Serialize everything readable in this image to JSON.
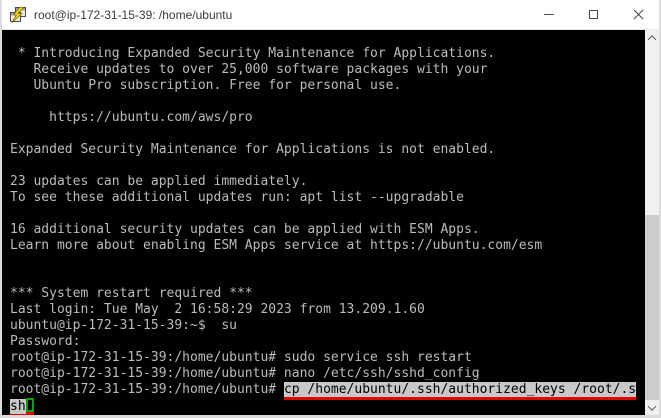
{
  "window": {
    "title": "root@ip-172-31-15-39: /home/ubuntu",
    "app_icon": "putty-icon",
    "controls": [
      "minimize",
      "maximize",
      "close"
    ]
  },
  "colors": {
    "terminal_bg": "#000000",
    "terminal_fg": "#bbbbbb",
    "selection_bg": "#c8c8c8",
    "selection_fg": "#000000",
    "cursor_green": "#00a400",
    "annotation_red": "#e60000",
    "titlebar_bg": "#ffffff",
    "scrollbar_track": "#f0f0f0",
    "scrollbar_thumb": "#cdcdcd"
  },
  "terminal": {
    "lines": [
      [
        {
          "t": ""
        }
      ],
      [
        {
          "t": " * Introducing Expanded Security Maintenance for Applications."
        }
      ],
      [
        {
          "t": "   Receive updates to over 25,000 software packages with your"
        }
      ],
      [
        {
          "t": "   Ubuntu Pro subscription. Free for personal use."
        }
      ],
      [
        {
          "t": ""
        }
      ],
      [
        {
          "t": "     https://ubuntu.com/aws/pro"
        }
      ],
      [
        {
          "t": ""
        }
      ],
      [
        {
          "t": "Expanded Security Maintenance for Applications is not enabled."
        }
      ],
      [
        {
          "t": ""
        }
      ],
      [
        {
          "t": "23 updates can be applied immediately."
        }
      ],
      [
        {
          "t": "To see these additional updates run: apt list --upgradable"
        }
      ],
      [
        {
          "t": ""
        }
      ],
      [
        {
          "t": "16 additional security updates can be applied with ESM Apps."
        }
      ],
      [
        {
          "t": "Learn more about enabling ESM Apps service at https://ubuntu.com/esm"
        }
      ],
      [
        {
          "t": ""
        }
      ],
      [
        {
          "t": ""
        }
      ],
      [
        {
          "t": "*** System restart required ***"
        }
      ],
      [
        {
          "t": "Last login: Tue May  2 16:58:29 2023 from 13.209.1.60"
        }
      ],
      [
        {
          "t": "ubuntu@ip-172-31-15-39:~$  su"
        }
      ],
      [
        {
          "t": "Password:"
        }
      ],
      [
        {
          "t": "root@ip-172-31-15-39:/home/ubuntu# sudo service ssh restart"
        }
      ],
      [
        {
          "t": "root@ip-172-31-15-39:/home/ubuntu# nano /etc/ssh/sshd_config"
        }
      ],
      [
        {
          "t": "root@ip-172-31-15-39:/home/ubuntu# "
        },
        {
          "t": "cp /home/ubuntu/.ssh/authorized_keys /root/.s",
          "sel": true,
          "redline": true
        }
      ],
      [
        {
          "t": "sh",
          "sel": true,
          "redline": true
        },
        {
          "t": "",
          "cursor": true,
          "redline": true
        }
      ]
    ]
  }
}
